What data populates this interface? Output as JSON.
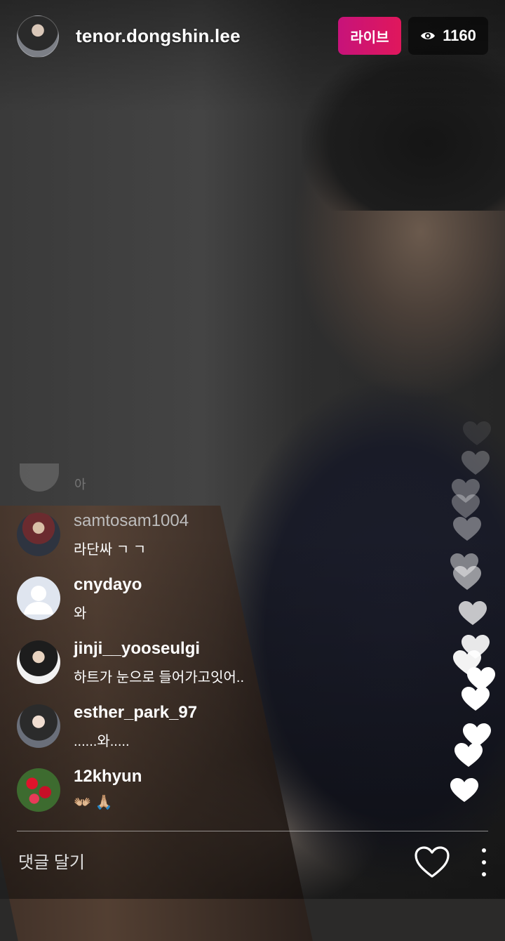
{
  "header": {
    "username": "tenor.dongshin.lee",
    "live_label": "라이브",
    "viewer_count": "1160"
  },
  "comments": [
    {
      "user": "samtosam1004",
      "text": "라단싸 ㄱ ㄱ"
    },
    {
      "user": "cnydayo",
      "text": "와"
    },
    {
      "user": "jinji__yooseulgi",
      "text": "하트가 눈으로 들어가고잇어.."
    },
    {
      "user": "esther_park_97",
      "text": "......와....."
    },
    {
      "user": "12khyun",
      "text": "👐🏼   🙏🏼"
    }
  ],
  "ghost_comment": {
    "text": "아"
  },
  "footer": {
    "comment_placeholder": "댓글 달기"
  },
  "colors": {
    "live_badge": "#e0175c",
    "accent": "#c7137a"
  }
}
